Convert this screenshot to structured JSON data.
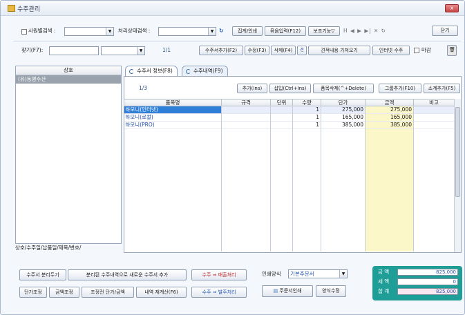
{
  "window": {
    "title": "수주관리",
    "close_label": "x"
  },
  "toolbar1": {
    "search_employee_label": "사원별검색 :",
    "search_status_label": "처리상태검색 :",
    "aggregate_print": "집계/인쇄",
    "bundle_input": "묶음입력(F12)",
    "aux_func": "보조기능▽",
    "close": "닫기",
    "nav": "H ◀ ▶ ▶| ✕ ↻"
  },
  "toolbar2": {
    "find_label": "찾기(F7):",
    "page": "1/1",
    "add_order": "수주서추가(F2)",
    "edit": "수정(F3)",
    "delete": "삭제(F4)",
    "fetch_estimate": "견적내용 가져오기",
    "internet_order": "인터넷 수주",
    "deadline_label": "마감"
  },
  "left_panel": {
    "header": "상호",
    "selected_item": "(유)동명수산",
    "bottom_tabs": "상호/수주일/납품일/제목/번호/"
  },
  "tabs": {
    "order_info": "수주서 정보(F8)",
    "order_detail": "수주내역(F9)"
  },
  "detail_toolbar": {
    "page": "1/3",
    "add": "추가(Ins)",
    "insert": "삽입(Ctrl+Ins)",
    "delete_item": "품목삭제(^+Delete)",
    "group_add": "그룹추가(F10)",
    "subtotal_add": "소계추가(F5)"
  },
  "grid": {
    "headers": [
      "품목명",
      "규격",
      "단위",
      "수량",
      "단가",
      "금액",
      "비고"
    ],
    "rows": [
      {
        "name": "하모니(인터넷)",
        "spec": "",
        "unit": "",
        "qty": "1",
        "price": "275,000",
        "amount": "275,000",
        "note": ""
      },
      {
        "name": "하모니(로컬)",
        "spec": "",
        "unit": "",
        "qty": "1",
        "price": "165,000",
        "amount": "165,000",
        "note": ""
      },
      {
        "name": "하모니(PRO)",
        "spec": "",
        "unit": "",
        "qty": "1",
        "price": "385,000",
        "amount": "385,000",
        "note": ""
      }
    ]
  },
  "bottom": {
    "split_order": "수주서 분리두기",
    "new_order_from_split": "분리된 수주내역으로 새로운 수주서 추가",
    "order_to_sales": "수주 ⇒ 매출처리",
    "order_to_purchase": "수주 ⇒ 발주처리",
    "unit_price_adjust": "단가조정",
    "amount_adjust": "금액조정",
    "before_adjust": "조정전 단가/금액",
    "recalc": "내역 재계산(F6)",
    "print_format_label": "인쇄양식",
    "print_format_value": "기본주문서",
    "order_print": "주문서인쇄",
    "format_edit": "양식수정"
  },
  "totals": {
    "amount_label": "금 액",
    "amount": "825,000",
    "tax_label": "세 액",
    "tax": "0",
    "total_label": "합 계",
    "total": "825,000"
  }
}
